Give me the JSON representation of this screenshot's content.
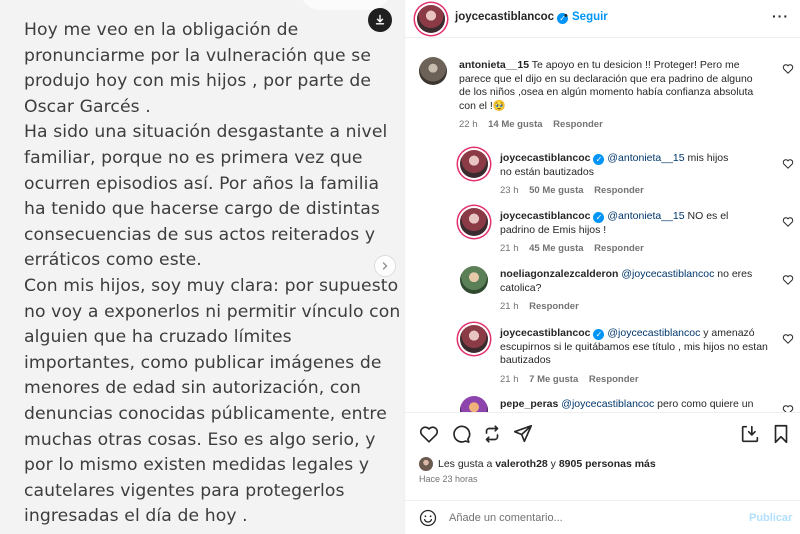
{
  "post_image": {
    "lines": [
      "Hoy me veo en la obligación de",
      "pronunciarme por la vulneración que se",
      "produjo hoy con mis hijos , por parte de",
      "Oscar Garcés .",
      "Ha sido una situación desgastante a nivel",
      "familiar, porque no es primera vez que",
      "ocurren episodios así. Por años  la familia",
      "ha tenido que hacerse cargo de distintas",
      "consecuencias de sus actos reiterados y",
      "erráticos como este.",
      "Con mis hijos, soy muy clara: por supuesto",
      "no voy a exponerlos ni permitir vínculo con",
      "alguien que ha cruzado límites",
      "importantes, como publicar imágenes de",
      "menores de edad sin autorización, con",
      "denuncias conocidas públicamente, entre",
      "muchas otras cosas. Eso es algo serio, y",
      "por lo mismo existen medidas legales y",
      "cautelares vigentes para protegerlos",
      "ingresadas el día de hoy ."
    ]
  },
  "header": {
    "username": "joycecastiblancoc",
    "verified_icon": "verified-badge-icon",
    "dot": "•",
    "follow_label": "Seguir",
    "more_icon": "more-options-icon",
    "more_glyph": "···"
  },
  "comments": [
    {
      "user": "antonieta__15",
      "text": "Te apoyo en tu desicion !! Proteger! Pero me parece que el dijo en su declaración que era padrino de alguno de los niños ,osea en algún momento había confianza absoluta con el !🥹",
      "time": "22 h",
      "likes": "14 Me gusta",
      "reply": "Responder"
    },
    {
      "user": "joycecastiblancoc",
      "mention": "@antonieta__15",
      "text": "mis hijos no están bautizados",
      "time": "23 h",
      "likes": "50 Me gusta",
      "reply": "Responder"
    },
    {
      "user": "joycecastiblancoc",
      "mention": "@antonieta__15",
      "text": "NO es el padrino de Emis hijos !",
      "time": "21 h",
      "likes": "45 Me gusta",
      "reply": "Responder"
    },
    {
      "user": "noeliagonzalezcalderon",
      "mention": "@joycecastiblancoc",
      "text": "no eres catolica?",
      "time": "21 h",
      "reply": "Responder"
    },
    {
      "user": "joycecastiblancoc",
      "mention": "@joycecastiblancoc",
      "text": "y amenazó escupirnos si le quitábamos ese título , mis hijos no estan bautizados",
      "time": "21 h",
      "likes": "7 Me gusta",
      "reply": "Responder"
    },
    {
      "user": "pepe_peras",
      "mention": "@joycecastiblancoc",
      "text": "pero como quiere un"
    }
  ],
  "likes": {
    "prefix": "Les gusta a",
    "user": "valeroth28",
    "connector": "y",
    "others": "8905 personas más"
  },
  "time_ago": "Hace 23 horas",
  "add_comment": {
    "placeholder": "Añade un comentario...",
    "publish_label": "Publicar"
  },
  "colors": {
    "accent": "#0095f6",
    "publish_disabled": "#b2dffc",
    "mention": "#00376b",
    "muted": "#737373"
  }
}
